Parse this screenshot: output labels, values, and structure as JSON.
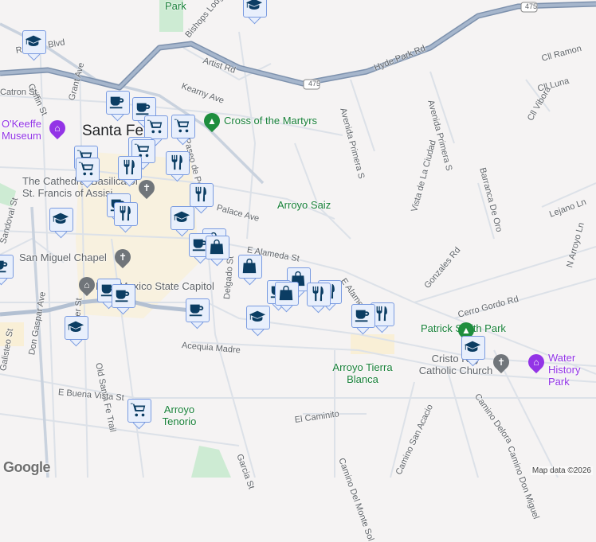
{
  "map": {
    "city_label": "Santa Fe",
    "streets": [
      "Rosario Blvd",
      "Griffin St",
      "Grant Ave",
      "Kearny Ave",
      "Artist Rd",
      "Hyde Park Rd",
      "Bishops Lodge Rd",
      "Avenida Primera S",
      "Avenida Primera S",
      "Cll Ramon",
      "Cll Luna",
      "Cll Vibora",
      "Barranca De Oro",
      "Vista de La Ciudad",
      "Lejano Ln",
      "N Arroyo Ln",
      "Gonzales Rd",
      "Cerro Gordo Rd",
      "E Alameda St",
      "E Alameda St",
      "Palace Ave",
      "Paseo de Peralta",
      "Delgado St",
      "Acequia Madre",
      "Galisteo St",
      "Don Gaspar Ave",
      "Webber St",
      "Old Santa Fe Trail",
      "E Buena Vista St",
      "El Caminito",
      "Garcia St",
      "Camino Delora",
      "Camino San Acacio",
      "Camino Don Miguel",
      "Camino Del Monte Sol",
      "Sandoval St",
      "Catron St"
    ],
    "route_shield": "475",
    "parks": [
      "Cross of the Martyrs",
      "Arroyo Saiz",
      "Patrick Smith Park",
      "Arroyo Tierra Blanca",
      "Arroyo Tenorio",
      "Park"
    ],
    "pois": [
      "O'Keeffe Museum",
      "The Cathedral Basilica of St. Francis of Assisi",
      "San Miguel Chapel",
      "New Mexico State Capitol",
      "Cristo Rey Catholic Church",
      "Water History Park"
    ],
    "marker_types": [
      "coffee-icon",
      "shopping-cart-icon",
      "restaurant-icon",
      "school-icon",
      "shopping-bag-icon"
    ],
    "colors": {
      "marker_fill": "#e8effc",
      "marker_border": "#7a9be0",
      "marker_icon": "#0b3d63",
      "park_text": "#188038",
      "museum_text": "#9334e6"
    }
  },
  "footer": {
    "attribution": "Map data ©2026",
    "logo": "Google"
  }
}
